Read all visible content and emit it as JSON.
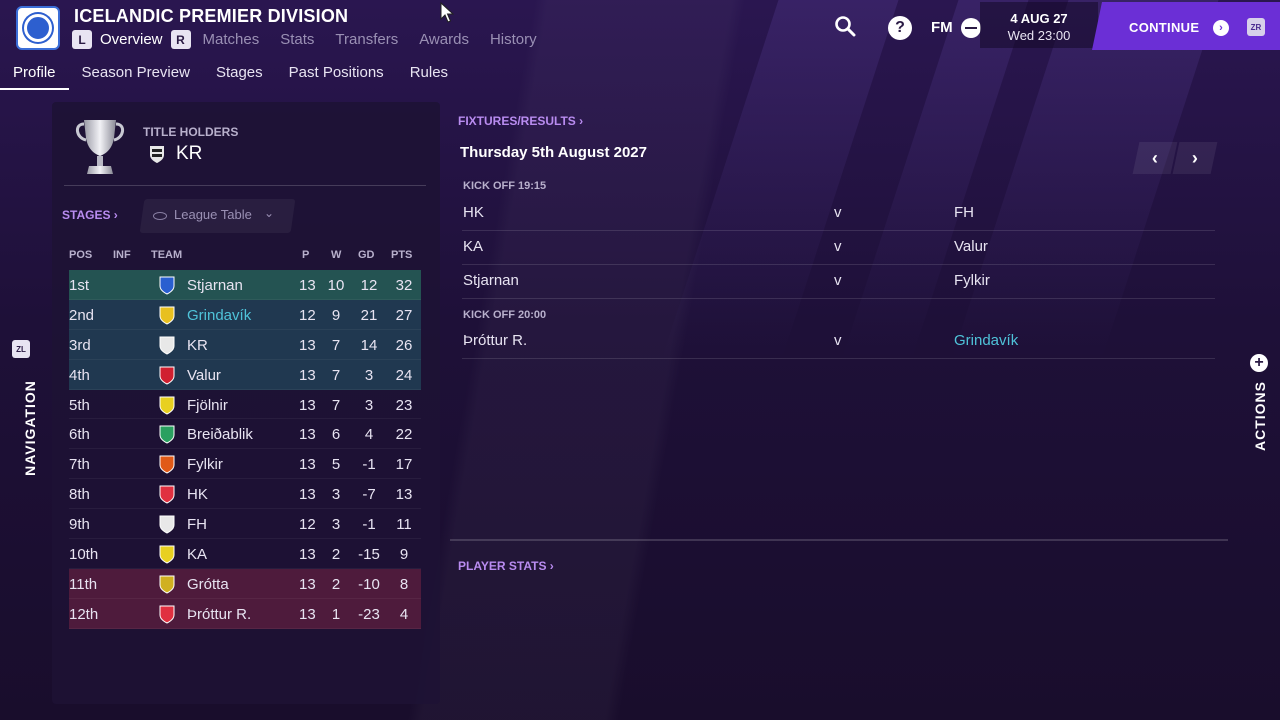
{
  "header": {
    "title": "ICELANDIC PREMIER DIVISION",
    "kbd_left": "L",
    "kbd_right": "R",
    "subnav": [
      "Overview",
      "Matches",
      "Stats",
      "Transfers",
      "Awards",
      "History"
    ],
    "page_tabs": [
      "Profile",
      "Season Preview",
      "Stages",
      "Past Positions",
      "Rules"
    ],
    "fm_label": "FM",
    "help_label": "?",
    "date": "4 AUG 27",
    "time": "Wed 23:00",
    "continue_label": "CONTINUE",
    "continue_key": "ZR"
  },
  "side": {
    "nav_key": "ZL",
    "nav_label": "NAVIGATION",
    "actions_label": "ACTIONS"
  },
  "title_holders": {
    "label": "TITLE HOLDERS",
    "team": "KR"
  },
  "stages": {
    "link": "STAGES ›",
    "selected": "League Table"
  },
  "table": {
    "headers": {
      "pos": "POS",
      "inf": "INF",
      "team": "TEAM",
      "p": "P",
      "w": "W",
      "gd": "GD",
      "pts": "PTS"
    },
    "rows": [
      {
        "pos": "1st",
        "team": "Stjarnan",
        "p": "13",
        "w": "10",
        "gd": "12",
        "pts": "32",
        "badge": "#2a5fd0"
      },
      {
        "pos": "2nd",
        "team": "Grindavík",
        "p": "12",
        "w": "9",
        "gd": "21",
        "pts": "27",
        "badge": "#e8c020"
      },
      {
        "pos": "3rd",
        "team": "KR",
        "p": "13",
        "w": "7",
        "gd": "14",
        "pts": "26",
        "badge": "#e8e8e8"
      },
      {
        "pos": "4th",
        "team": "Valur",
        "p": "13",
        "w": "7",
        "gd": "3",
        "pts": "24",
        "badge": "#d02030"
      },
      {
        "pos": "5th",
        "team": "Fjölnir",
        "p": "13",
        "w": "7",
        "gd": "3",
        "pts": "23",
        "badge": "#e8d020"
      },
      {
        "pos": "6th",
        "team": "Breiðablik",
        "p": "13",
        "w": "6",
        "gd": "4",
        "pts": "22",
        "badge": "#2aa060"
      },
      {
        "pos": "7th",
        "team": "Fylkir",
        "p": "13",
        "w": "5",
        "gd": "-1",
        "pts": "17",
        "badge": "#e05a18"
      },
      {
        "pos": "8th",
        "team": "HK",
        "p": "13",
        "w": "3",
        "gd": "-7",
        "pts": "13",
        "badge": "#e03040"
      },
      {
        "pos": "9th",
        "team": "FH",
        "p": "12",
        "w": "3",
        "gd": "-1",
        "pts": "11",
        "badge": "#e8e8e8"
      },
      {
        "pos": "10th",
        "team": "KA",
        "p": "13",
        "w": "2",
        "gd": "-15",
        "pts": "9",
        "badge": "#e8d020"
      },
      {
        "pos": "11th",
        "team": "Grótta",
        "p": "13",
        "w": "2",
        "gd": "-10",
        "pts": "8",
        "badge": "#d0b020"
      },
      {
        "pos": "12th",
        "team": "Þróttur R.",
        "p": "13",
        "w": "1",
        "gd": "-23",
        "pts": "4",
        "badge": "#e03040"
      }
    ]
  },
  "fixtures": {
    "link": "FIXTURES/RESULTS ›",
    "date": "Thursday 5th August 2027",
    "groups": [
      {
        "kickoff": "KICK OFF 19:15",
        "matches": [
          {
            "home": "HK",
            "v": "v",
            "away": "FH"
          },
          {
            "home": "KA",
            "v": "v",
            "away": "Valur"
          },
          {
            "home": "Stjarnan",
            "v": "v",
            "away": "Fylkir"
          }
        ]
      },
      {
        "kickoff": "KICK OFF 20:00",
        "matches": [
          {
            "home": "Þróttur R.",
            "v": "v",
            "away": "Grindavík"
          }
        ]
      }
    ]
  },
  "player_stats": {
    "link": "PLAYER STATS ›"
  },
  "colors": {
    "accent": "#6b2fd6",
    "link": "#4fc3d9",
    "section_link": "#b98cf0",
    "promotion": "#287d64",
    "relegation": "#8c2846"
  }
}
